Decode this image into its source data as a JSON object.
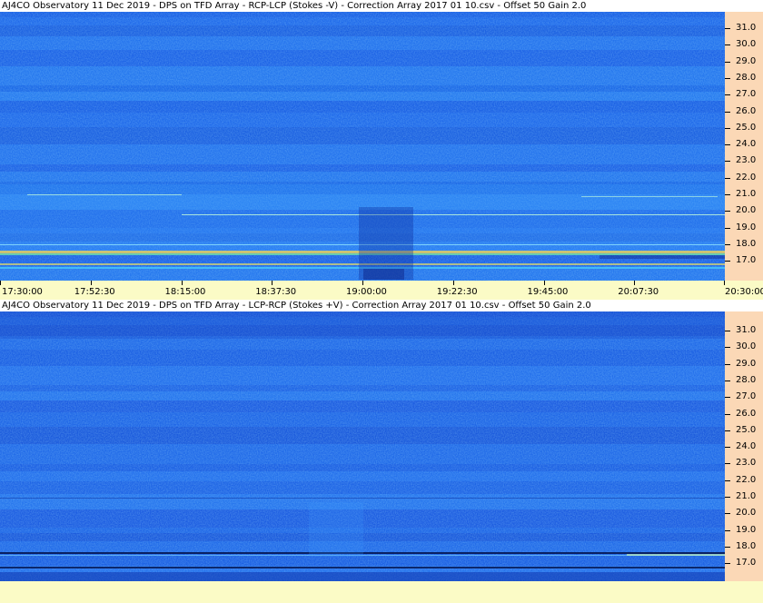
{
  "panels": [
    {
      "title": "AJ4CO Observatory 11 Dec 2019  -  DPS on TFD Array  -  RCP-LCP (Stokes -V)  -  Correction Array 2017 01 10.csv  -  Offset 50  Gain 2.0",
      "variant": "rcp-lcp"
    },
    {
      "title": "AJ4CO Observatory 11 Dec 2019  -  DPS on TFD Array  -  LCP-RCP (Stokes +V)  -  Correction Array 2017 01 10.csv  -  Offset 50  Gain 2.0",
      "variant": "lcp-rcp"
    }
  ],
  "frequency_axis": {
    "labels": [
      "31.0",
      "30.0",
      "29.0",
      "28.0",
      "27.0",
      "26.0",
      "25.0",
      "24.0",
      "23.0",
      "22.0",
      "21.0",
      "20.0",
      "19.0",
      "18.0",
      "17.0"
    ],
    "values": [
      31,
      30,
      29,
      28,
      27,
      26,
      25,
      24,
      23,
      22,
      21,
      20,
      19,
      18,
      17
    ]
  },
  "time_axis": {
    "labels": [
      "17:30:00",
      "17:52:30",
      "18:15:00",
      "18:37:30",
      "19:00:00",
      "19:22:30",
      "19:45:00",
      "20:07:30",
      "20:30:00"
    ]
  },
  "colors": {
    "spectrogram_base": "#1e64e6",
    "frequency_axis_bg": "#fbd8b6",
    "time_axis_bg": "#fbfbc6"
  }
}
